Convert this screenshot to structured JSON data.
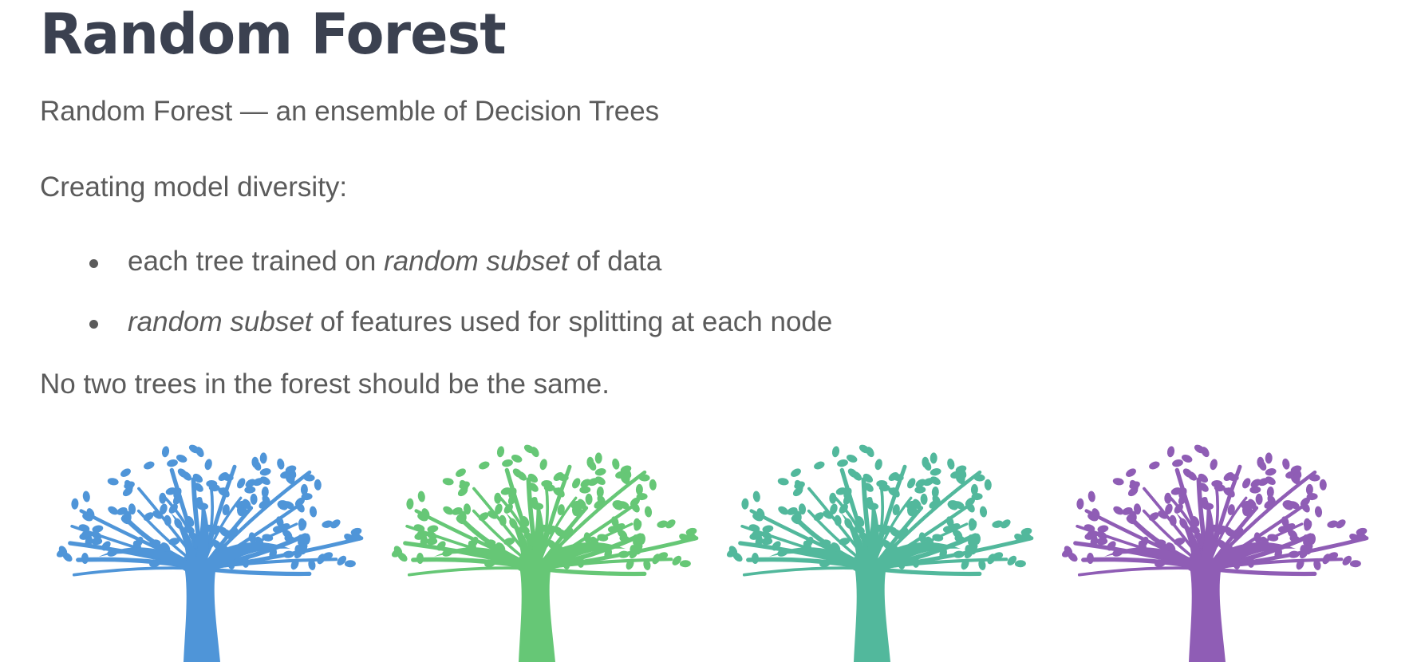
{
  "title": "Random Forest",
  "lines": {
    "intro": "Random Forest — an ensemble of Decision Trees",
    "diversity": "Creating model diversity:",
    "closing": "No two trees in the forest should be the same."
  },
  "bullets": [
    {
      "pre": "each tree trained on ",
      "em": "random subset",
      "post": " of data"
    },
    {
      "pre": "",
      "em": "random subset",
      "post": " of features used for splitting at each node"
    }
  ],
  "trees": [
    {
      "color": "#4f95d8"
    },
    {
      "color": "#66c776"
    },
    {
      "color": "#52b89c"
    },
    {
      "color": "#8f5db5"
    }
  ]
}
